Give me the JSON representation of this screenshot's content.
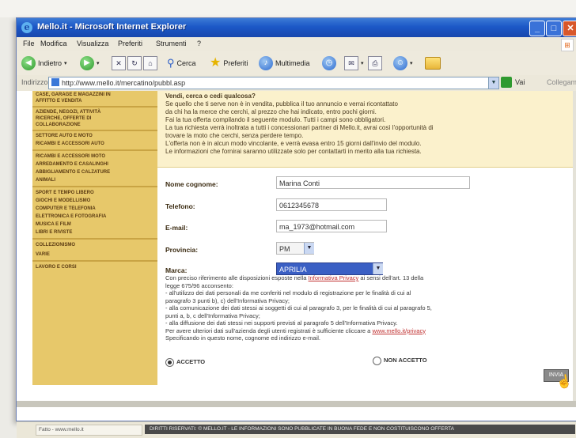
{
  "window": {
    "title": "Mello.it - Microsoft Internet Explorer",
    "controls": [
      "_",
      "□",
      "✕"
    ]
  },
  "menu": [
    "File",
    "Modifica",
    "Visualizza",
    "Preferiti",
    "Strumenti",
    "?"
  ],
  "toolbar": {
    "back_label": "Indietro",
    "search_label": "Cerca",
    "favorites_label": "Preferiti",
    "multimedia_label": "Multimedia"
  },
  "address": {
    "label": "Indirizzo",
    "url": "http://www.mello.it/mercatino/pubbl.asp",
    "go_label": "Vai",
    "links_label": "Collegamenti"
  },
  "sidebar": {
    "items": [
      "Case, Garage e Magazzini in",
      "Affitto e Vendita",
      "Aziende, Negozi, Attività",
      "Ricerche, Offerte di",
      "Collaborazione",
      "Settore Auto e Moto",
      "Ricambi e Accessori Auto",
      "Ricambi e Accessori Moto",
      "Arredamento e Casalinghi",
      "Abbigliamento e Calzature",
      "Animali",
      "Sport e Tempo Libero",
      "Giochi e Modellismo",
      "Computer e Telefonia",
      "Elettronica e Fotografia",
      "Musica e Film",
      "Libri e Riviste",
      "Collezionismo",
      "Varie",
      "Lavoro e Corsi"
    ]
  },
  "notice": {
    "lines": [
      "Vendi, cerca o cedi qualcosa?",
      "Se quello che ti serve non è in vendita, pubblica il tuo annuncio e verrai ricontattato",
      "da chi ha la merce che cerchi, al prezzo che hai indicato, entro pochi giorni.",
      "Fai la tua offerta compilando il seguente modulo. Tutti i campi sono obbligatori.",
      "La tua richiesta verrà inoltrata a tutti i concessionari partner di Mello.it, avrai così l'opportunità di",
      "trovare la moto che cerchi, senza perdere tempo.",
      "L'offerta non è in alcun modo vincolante, e verrà evasa entro 15 giorni dall'invio del modulo.",
      "Le informazioni che fornirai saranno utilizzate solo per contattarti in merito alla tua richiesta."
    ]
  },
  "form": {
    "name": {
      "label": "Nome cognome:",
      "value": "Marina Conti"
    },
    "phone": {
      "label": "Telefono:",
      "value": "0612345678"
    },
    "email": {
      "label": "E-mail:",
      "value": "ma_1973@hotmail.com"
    },
    "province": {
      "label": "Provincia:",
      "value": "PM"
    },
    "brand": {
      "label": "Marca:",
      "value": "APRILIA"
    }
  },
  "privacy": {
    "pre": "Con preciso riferimento alle disposizioni esposte nella",
    "link": "Informativa Privacy",
    "post": "ai sensi dell'art. 13 della",
    "lines": [
      "legge 675/96 acconsento:",
      "- all'utilizzo dei dati personali da me conferiti nel modulo di registrazione per le finalità di cui al",
      "  paragrafo 3 punti b), c) dell'Informativa Privacy;",
      "- alla comunicazione dei dati stessi ai soggetti di cui al paragrafo 3, per le finalità di cui al paragrafo 5,",
      "  punti a, b, c dell'Informativa Privacy;",
      "- alla diffusione dei dati stessi nei supporti previsti al paragrafo 5 dell'Informativa Privacy.",
      "Per avere ulteriori dati sull'azienda degli utenti registrati è sufficiente cliccare a"
    ],
    "link2": "www.mello.it/privacy",
    "final": "Specificando in questo nome, cognome ed indirizzo e-mail.",
    "accept_label": "ACCETTO",
    "reject_label": "NON ACCETTO",
    "submit_label": "INVIA"
  },
  "status": {
    "left": "Fatto - www.mello.it",
    "right": "DIRITTI RISERVATI: © MELLO.IT - LE INFORMAZIONI SONO PUBBLICATE IN BUONA FEDE E NON COSTITUISCONO OFFERTA"
  }
}
